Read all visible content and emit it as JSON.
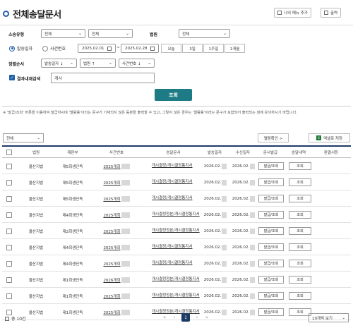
{
  "header": {
    "title": "전체송달문서",
    "menu_add_label": "나의 메뉴 추가",
    "print_label": "출력"
  },
  "filters": {
    "case_type_label": "소송유형",
    "case_type_value": "전체",
    "case_type_value2": "전체",
    "court_label": "법원",
    "court_value": "전체",
    "radio_issue_date": "발송일자",
    "radio_case_no": "사건번호",
    "date_from": "2025.02.01",
    "date_to": "2025.02.28",
    "date_sep": "~",
    "periods": [
      "오늘",
      "3일",
      "1주일",
      "1개월"
    ],
    "sort_label": "정렬순서",
    "sort1": "발송일자 ↓",
    "sort2": "법원 ↑",
    "sort3": "사건번호 ↓",
    "result_search_label": "결과내재검색",
    "result_search_value": "개시",
    "search_button": "조회"
  },
  "notice": "※ '발급/조회' 버튼을 이용하여 발급하시며 '열람용'이라는 문구가 기재되지 않은 등본을 출력할 수 있고, 그렇지 않은 경우는 '열람용'이라는 문구가 포함되어 출력되는 점에 유의하시기 바랍니다.",
  "toolbar": {
    "filter_value": "전체",
    "reading_confirm": "열람확인 >",
    "excel_save": "엑셀로 저장",
    "excel_icon_text": "X"
  },
  "table": {
    "headers": [
      "법원",
      "재판부",
      "사건번호",
      "송달문서",
      "발송일자",
      "수신일자",
      "문서발급",
      "송달내역",
      "판결서등"
    ],
    "rows": [
      {
        "court": "울산지법",
        "division": "제5회생단독",
        "case": "2025개회",
        "doc": "개시결정/개시결정통지서",
        "sent": "2026.02.",
        "recv": "2026.02.",
        "issue": "발급/조회",
        "history": "조회"
      },
      {
        "court": "울산지법",
        "division": "제5회생단독",
        "case": "2025개회",
        "doc": "개시결정/개시결정통지서",
        "sent": "2026.02.",
        "recv": "2026.02.",
        "issue": "발급/조회",
        "history": "조회"
      },
      {
        "court": "울산지법",
        "division": "제5회생단독",
        "case": "2025개회",
        "doc": "개시결정/개시결정통지서",
        "sent": "2026.02.",
        "recv": "2026.02.",
        "issue": "발급/조회",
        "history": "조회"
      },
      {
        "court": "울산지법",
        "division": "제4회생단독",
        "case": "2025개회",
        "doc": "개시결정정본/개시결정통지서",
        "sent": "2026.02.",
        "recv": "2026.02.",
        "issue": "발급/조회",
        "history": "조회"
      },
      {
        "court": "울산지법",
        "division": "제2회생단독",
        "case": "2025개회",
        "doc": "개시결정정본/개시결정통지서",
        "sent": "2026.02.",
        "recv": "2026.02.",
        "issue": "발급/조회",
        "history": "조회"
      },
      {
        "court": "울산지법",
        "division": "제4회생단독",
        "case": "2025개회",
        "doc": "개시결정/개시결정통지서",
        "sent": "2026.02.",
        "recv": "2026.02.",
        "issue": "발급/조회",
        "history": "조회"
      },
      {
        "court": "울산지법",
        "division": "제4회생단독",
        "case": "2025개회",
        "doc": "개시결정/개시결정통지서",
        "sent": "2026.02.",
        "recv": "2026.02.",
        "issue": "발급/조회",
        "history": "조회"
      },
      {
        "court": "울산지법",
        "division": "제1회생단독",
        "case": "2026개회",
        "doc": "개시결정정본/개시결정통지서",
        "sent": "2026.02.",
        "recv": "2026.02.",
        "issue": "발급/조회",
        "history": "조회"
      },
      {
        "court": "울산지법",
        "division": "제1회생단독",
        "case": "2025개회",
        "doc": "개시결정정본/개시결정통지서",
        "sent": "2026.02.",
        "recv": "2026.02.",
        "issue": "발급/조회",
        "history": "조회"
      },
      {
        "court": "울산지법",
        "division": "제1회생단독",
        "case": "2025개회",
        "doc": "개시결정정본/개시결정통지서",
        "sent": "2026.02.",
        "recv": "2026.02.",
        "issue": "발급/조회",
        "history": "조회"
      }
    ]
  },
  "footer": {
    "total": "총 10건",
    "page_first": "«",
    "page_prev": "‹",
    "current_page": "1",
    "page_next": "›",
    "page_last": "»",
    "per_page": "10개씩 보기"
  },
  "colors": {
    "accent": "#1e5fa8",
    "search_button": "#1c7b84",
    "table_header_border": "#1e3b66"
  }
}
